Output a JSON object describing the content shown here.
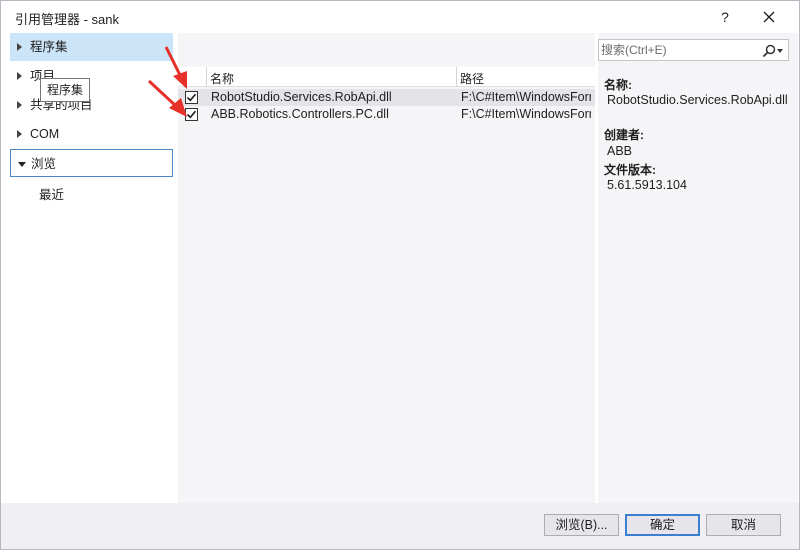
{
  "window": {
    "title": "引用管理器 - sank",
    "help_label": "?"
  },
  "nav": {
    "items": [
      {
        "label": "程序集"
      },
      {
        "label": "项目"
      },
      {
        "label": "共享的项目"
      },
      {
        "label": "COM"
      },
      {
        "label": "浏览"
      },
      {
        "label": "最近"
      }
    ],
    "tooltip": "程序集"
  },
  "list": {
    "columns": {
      "name": "名称",
      "path": "路径"
    },
    "rows": [
      {
        "checked": true,
        "name": "RobotStudio.Services.RobApi.dll",
        "path": "F:\\C#Item\\WindowsFormsApp"
      },
      {
        "checked": true,
        "name": "ABB.Robotics.Controllers.PC.dll",
        "path": "F:\\C#Item\\WindowsFormsApp"
      }
    ]
  },
  "search": {
    "placeholder": "搜索(Ctrl+E)"
  },
  "details": {
    "name_label": "名称:",
    "name_value": "RobotStudio.Services.RobApi.dll",
    "creator_label": "创建者:",
    "creator_value": "ABB",
    "version_label": "文件版本:",
    "version_value": "5.61.5913.104"
  },
  "footer": {
    "browse_label": "浏览(B)...",
    "ok_label": "确定",
    "cancel_label": "取消"
  },
  "colors": {
    "selection": "#cce4f7",
    "annotation_arrow": "#e8302a",
    "default_button_border": "#3c7fd0"
  }
}
